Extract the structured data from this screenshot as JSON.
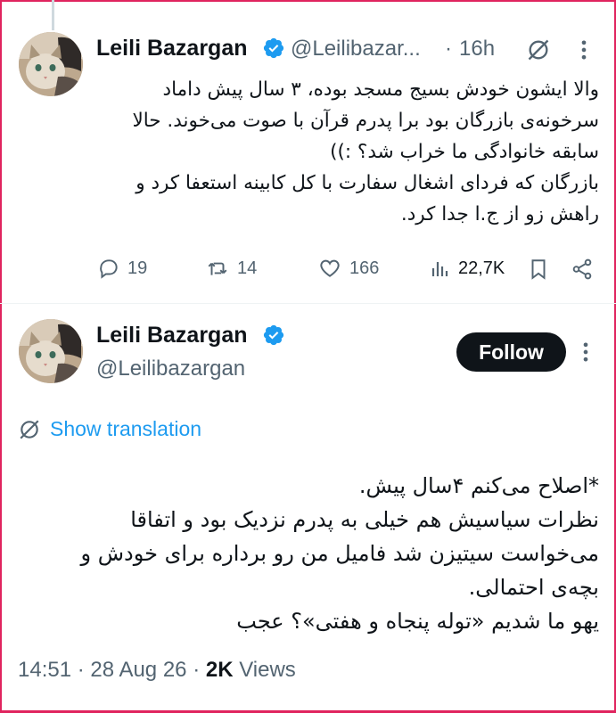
{
  "tweet1": {
    "author_name": "Leili Bazargan",
    "handle": "@Leilibazar...",
    "dot": "·",
    "time": "16h",
    "lines": [
      "والا ایشون خودش بسیج مسجد بوده، ۳ سال پیش داماد",
      "سرخونه‌ی بازرگان بود برا پدرم قرآن با صوت می‌خوند. حالا",
      "سابقه خانوادگی ما خراب شد؟ :))",
      "بازرگان که فردای اشغال سفارت با کل کابینه استعفا کرد و",
      "راهش زو از ج.ا جدا کرد."
    ],
    "actions": {
      "replies": "19",
      "retweets": "14",
      "likes": "166",
      "views": "22,7K"
    }
  },
  "tweet2": {
    "author_name": "Leili Bazargan",
    "handle": "@Leilibazargan",
    "follow_label": "Follow",
    "translate_label": "Show translation",
    "lines": [
      "*اصلاح می‌کنم ۴سال پیش.",
      "نظرات سیاسیش هم خیلی به پدرم نزدیک بود و اتفاقا",
      "می‌خواست سیتیزن شد فامیل من رو برداره برای خودش و",
      "بچه‌ی احتمالی.",
      "یهو ما شدیم «توله پنجاه و هفتی»؟ عجب"
    ],
    "time": "14:51",
    "dot1": "·",
    "date": "28 Aug 26",
    "dot2": "·",
    "views_count": "2K",
    "views_label": "Views"
  },
  "colors": {
    "accent": "#1d9bf0",
    "text": "#0f1419",
    "muted": "#536471",
    "border": "#e0245e"
  }
}
